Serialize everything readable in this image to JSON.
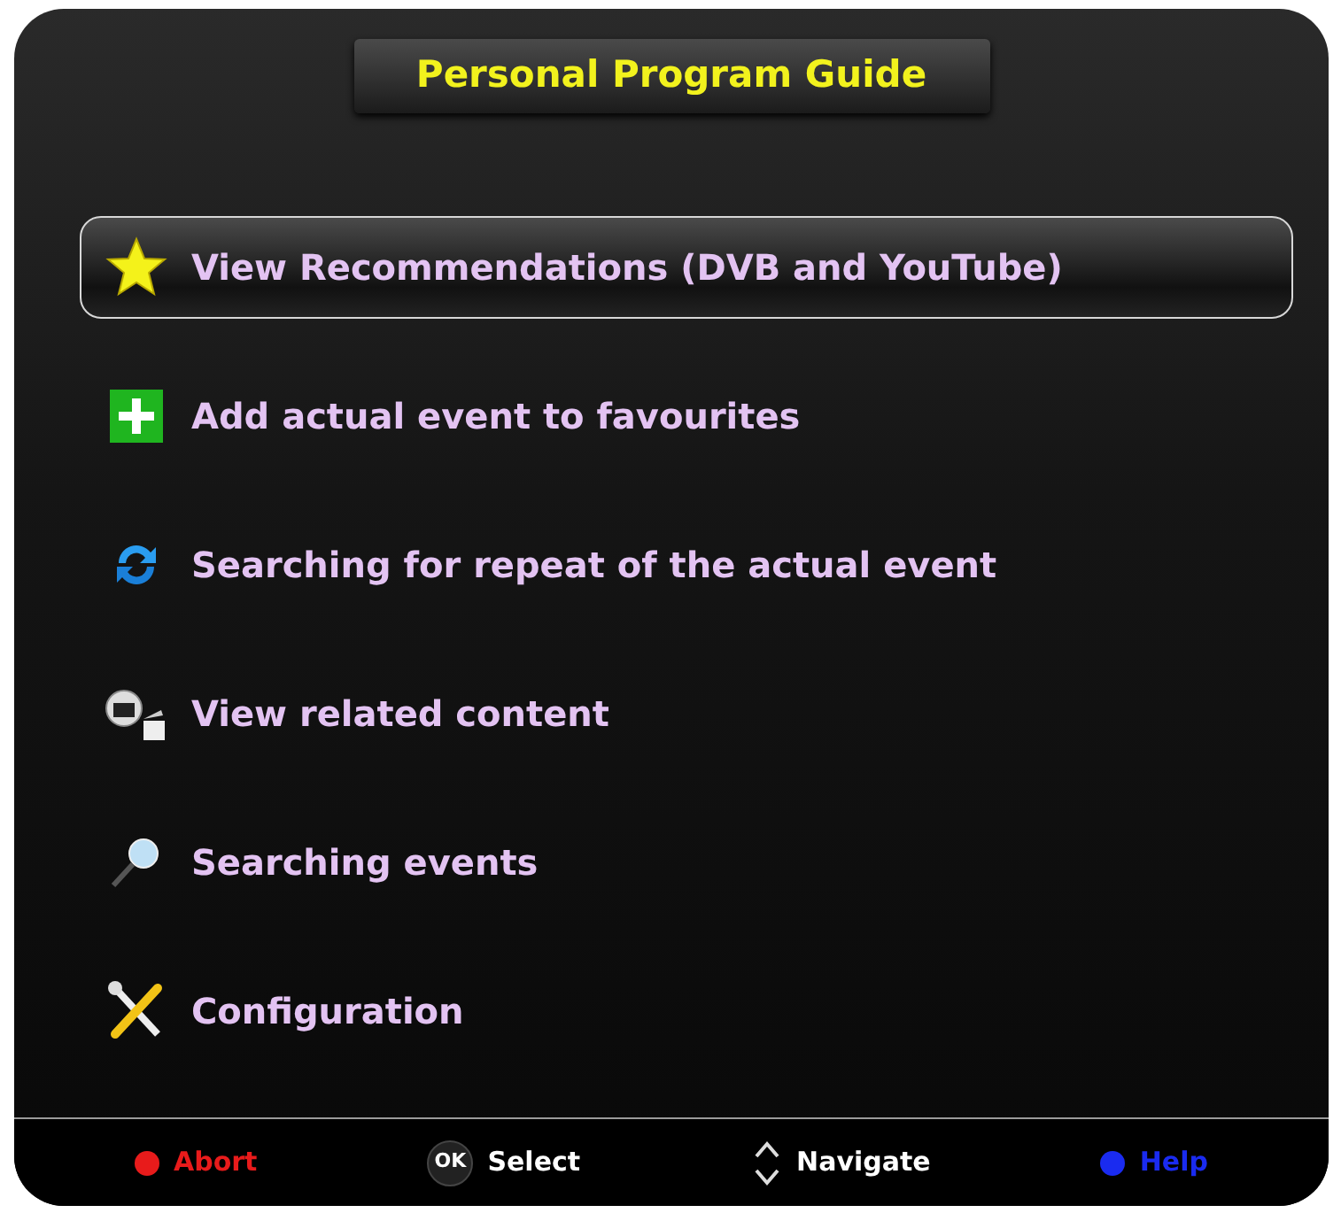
{
  "title": "Personal Program Guide",
  "menu": [
    {
      "label": "View Recommendations (DVB and YouTube)",
      "kind": "star",
      "selected": true
    },
    {
      "label": "Add actual event to favourites",
      "kind": "plus",
      "selected": false
    },
    {
      "label": "Searching for repeat of the actual event",
      "kind": "repeat",
      "selected": false
    },
    {
      "label": "View related content",
      "kind": "related",
      "selected": false
    },
    {
      "label": "Searching events",
      "kind": "search",
      "selected": false
    },
    {
      "label": "Configuration",
      "kind": "tools",
      "selected": false
    }
  ],
  "footer": [
    {
      "kind": "dot",
      "color": "#e81b1b",
      "label": "Abort"
    },
    {
      "kind": "ok",
      "key": "OK",
      "label": "Select"
    },
    {
      "kind": "updown",
      "label": "Navigate"
    },
    {
      "kind": "dot",
      "color": "#1a2bf0",
      "label": "Help"
    }
  ]
}
